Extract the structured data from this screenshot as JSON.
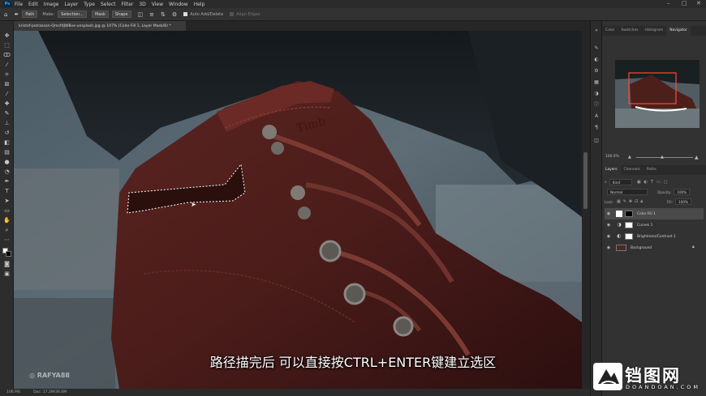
{
  "menu": {
    "app_logo": "Ps",
    "items": [
      "File",
      "Edit",
      "Image",
      "Layer",
      "Type",
      "Select",
      "Filter",
      "3D",
      "View",
      "Window",
      "Help"
    ]
  },
  "options_bar": {
    "tool_mode": "Path",
    "make_label": "Make:",
    "selection_button": "Selection...",
    "mask_button": "Mask",
    "shape_button": "Shape",
    "auto_add_delete": "Auto Add/Delete",
    "align_edges": "Align Edges"
  },
  "document": {
    "tab_title": "kristof-petrasson-QmcfdJW8ve-unsplash.jpg @ 107% (Color Fill 1, Layer Mask/8) *"
  },
  "status_bar": {
    "zoom": "106.9%",
    "doc_size": "Doc: 17.2M/36.0M"
  },
  "panels": {
    "top_tabs": [
      "Color",
      "Swatches",
      "Histogram",
      "Navigator"
    ],
    "active_top_tab": "Navigator",
    "navigator_zoom": "106.9%",
    "layer_tabs": [
      "Layers",
      "Channels",
      "Paths"
    ],
    "active_layer_tab": "Layers",
    "kind_filter": "Kind",
    "blend_mode": "Normal",
    "opacity_label": "Opacity:",
    "opacity_value": "100%",
    "lock_label": "Lock:",
    "fill_label": "Fill:",
    "fill_value": "100%",
    "layers": [
      {
        "name": "Color Fill 1",
        "selected": true,
        "icon": "fill-icon",
        "mask": "black"
      },
      {
        "name": "Curves 1",
        "selected": false,
        "icon": "curves-icon",
        "mask": "white"
      },
      {
        "name": "Brightness/Contrast 1",
        "selected": false,
        "icon": "brightness-icon",
        "mask": "white"
      },
      {
        "name": "Background",
        "selected": false,
        "icon": "image-icon",
        "mask": "none"
      }
    ]
  },
  "overlay": {
    "subtitle": "路径描完后 可以直接按CTRL+ENTER键建立选区",
    "watermark": "RAFYA88",
    "site_name_cn": "铛图网",
    "site_name_en": "DOANDOAN.COM"
  }
}
